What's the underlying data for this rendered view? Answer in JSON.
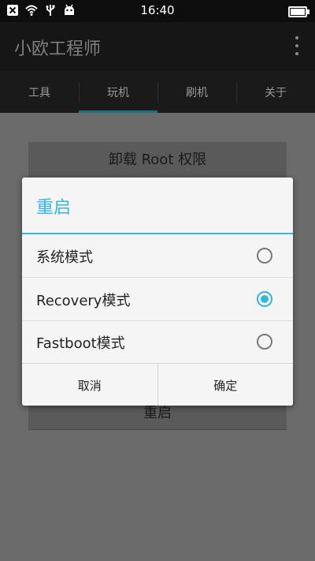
{
  "status_bar": {
    "time": "16:40",
    "icons": [
      "close-box-icon",
      "wifi-icon",
      "usb-icon",
      "android-icon"
    ],
    "battery_level": 1.0
  },
  "app_bar": {
    "title": "小欧工程师"
  },
  "tabs": [
    {
      "label": "工具"
    },
    {
      "label": "玩机"
    },
    {
      "label": "刷机"
    },
    {
      "label": "关于"
    }
  ],
  "background": {
    "top_button": "卸载 Root 权限",
    "bottom_button": "重启"
  },
  "dialog": {
    "title": "重启",
    "options": [
      {
        "label": "系统模式",
        "checked": false
      },
      {
        "label": "Recovery模式",
        "checked": true
      },
      {
        "label": "Fastboot模式",
        "checked": false
      }
    ],
    "cancel_label": "取消",
    "confirm_label": "确定"
  },
  "colors": {
    "accent": "#33b5e5",
    "tab_indicator": "#1f6f85"
  }
}
